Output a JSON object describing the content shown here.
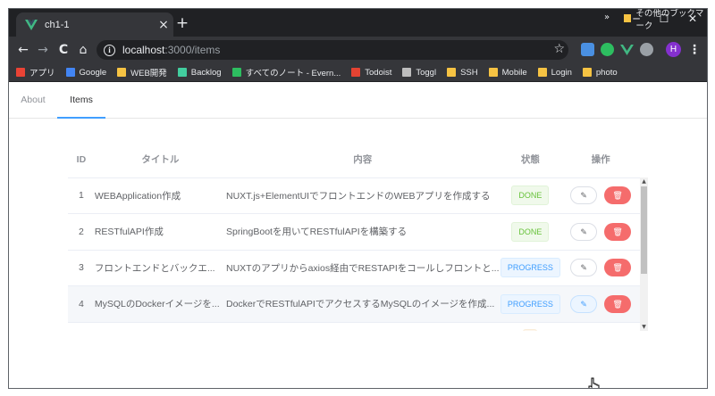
{
  "browser": {
    "tab_title": "ch1-1",
    "tab_close": "×",
    "new_tab": "+",
    "window_controls": {
      "minimize": "─",
      "maximize": "☐",
      "close": "✕"
    },
    "nav": {
      "back": "←",
      "forward": "→",
      "reload": "C",
      "home": "⌂"
    },
    "url_host": "localhost",
    "url_path": ":3000/items",
    "profile_initial": "H",
    "bookmarks": [
      {
        "label": "アプリ",
        "color": "#ea4335",
        "icon": "apps-grid-icon"
      },
      {
        "label": "Google",
        "color": "#4285f4",
        "icon": "google-icon"
      },
      {
        "label": "WEB開発",
        "color": "#f6c343",
        "icon": "folder-icon"
      },
      {
        "label": "Backlog",
        "color": "#42ce9f",
        "icon": "backlog-icon"
      },
      {
        "label": "すべてのノート - Evern...",
        "color": "#2dbe60",
        "icon": "evernote-icon"
      },
      {
        "label": "Todoist",
        "color": "#e44332",
        "icon": "todoist-icon"
      },
      {
        "label": "Toggl",
        "color": "#bdbdbd",
        "icon": "toggl-icon"
      },
      {
        "label": "SSH",
        "color": "#f6c343",
        "icon": "folder-icon"
      },
      {
        "label": "Mobile",
        "color": "#f6c343",
        "icon": "folder-icon"
      },
      {
        "label": "Login",
        "color": "#f6c343",
        "icon": "folder-icon"
      },
      {
        "label": "photo",
        "color": "#f6c343",
        "icon": "folder-icon"
      }
    ],
    "bookmarks_more": "»",
    "other_bookmarks": "その他のブックマーク"
  },
  "menu": {
    "items": [
      "About",
      "Items"
    ],
    "active_index": 1
  },
  "table": {
    "headers": {
      "id": "ID",
      "title": "タイトル",
      "body": "内容",
      "status": "状態",
      "ops": "操作"
    },
    "rows": [
      {
        "id": "1",
        "title": "WEBApplication作成",
        "body": "NUXT.js+ElementUIでフロントエンドのWEBアプリを作成する",
        "status": "DONE",
        "kind": "done"
      },
      {
        "id": "2",
        "title": "RESTfulAPI作成",
        "body": "SpringBootを用いてRESTfulAPIを構築する",
        "status": "DONE",
        "kind": "done"
      },
      {
        "id": "3",
        "title": "フロントエンドとバックエ...",
        "body": "NUXTのアプリからaxios経由でRESTAPIをコールしフロントと...",
        "status": "PROGRESS",
        "kind": "progress"
      },
      {
        "id": "4",
        "title": "MySQLのDockerイメージを...",
        "body": "DockerでRESTfulAPIでアクセスするMySQLのイメージを作成...",
        "status": "PROGRESS",
        "kind": "progress"
      },
      {
        "id": "",
        "title": "",
        "body": "",
        "status": "",
        "kind": "todo"
      }
    ],
    "edit_icon": "✎",
    "delete_icon": "🗑"
  },
  "colors": {
    "accent": "#409eff",
    "danger": "#f56c6c",
    "success": "#67c23a"
  }
}
